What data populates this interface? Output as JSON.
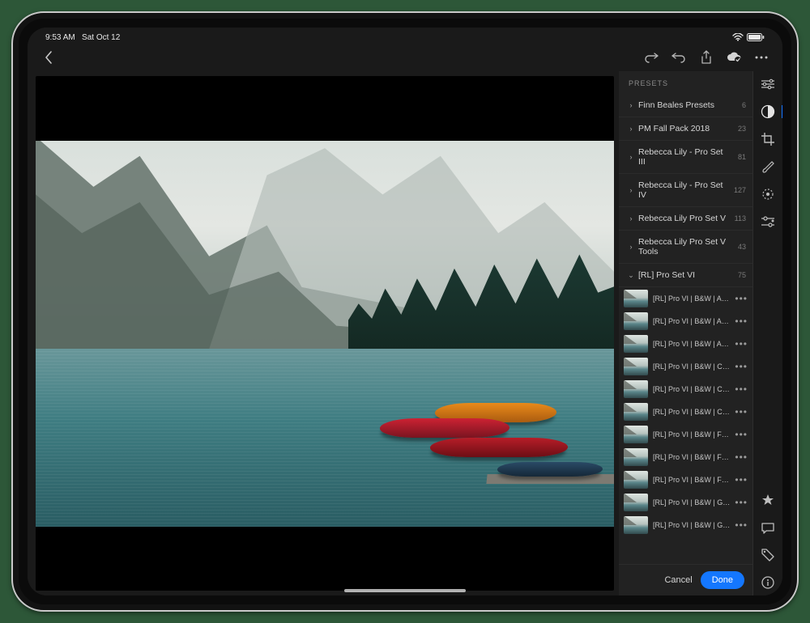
{
  "status": {
    "time": "9:53 AM",
    "date": "Sat Oct 12"
  },
  "sidebar": {
    "header": "PRESETS",
    "groups": [
      {
        "label": "Finn Beales Presets",
        "count": "6",
        "open": false
      },
      {
        "label": "PM Fall Pack 2018",
        "count": "23",
        "open": false
      },
      {
        "label": "Rebecca Lily - Pro Set III",
        "count": "81",
        "open": false
      },
      {
        "label": "Rebecca Lily - Pro Set IV",
        "count": "127",
        "open": false
      },
      {
        "label": "Rebecca Lily Pro Set V",
        "count": "113",
        "open": false
      },
      {
        "label": "Rebecca Lily Pro Set V Tools",
        "count": "43",
        "open": false
      },
      {
        "label": "[RL] Pro Set VI",
        "count": "75",
        "open": true
      }
    ],
    "presets": [
      {
        "label": "[RL] Pro VI | B&W | Arctic I"
      },
      {
        "label": "[RL] Pro VI | B&W | Arctic II"
      },
      {
        "label": "[RL] Pro VI | B&W | Arctic II"
      },
      {
        "label": "[RL] Pro VI | B&W | Casabl..."
      },
      {
        "label": "[RL] Pro VI | B&W | Casabl..."
      },
      {
        "label": "[RL] Pro VI | B&W | Casabl..."
      },
      {
        "label": "[RL] Pro VI | B&W | Fog I"
      },
      {
        "label": "[RL] Pro VI | B&W | Fog II"
      },
      {
        "label": "[RL] Pro VI | B&W | Fog III"
      },
      {
        "label": "[RL] Pro VI | B&W | Glacier I"
      },
      {
        "label": "[RL] Pro VI | B&W | Glacier II"
      }
    ],
    "footer": {
      "cancel": "Cancel",
      "done": "Done"
    }
  },
  "toolrail": {
    "top": [
      "sliders-icon",
      "presets-icon",
      "crop-icon",
      "brush-icon",
      "radial-icon",
      "selective-icon"
    ],
    "bottom": [
      "star-icon",
      "chat-icon",
      "tag-icon",
      "info-icon"
    ]
  },
  "topbar": {
    "back": "back",
    "right": [
      "redo-icon",
      "undo-icon",
      "share-icon",
      "cloud-icon",
      "more-icon"
    ]
  },
  "chevron_right": "›",
  "chevron_down": "⌄"
}
